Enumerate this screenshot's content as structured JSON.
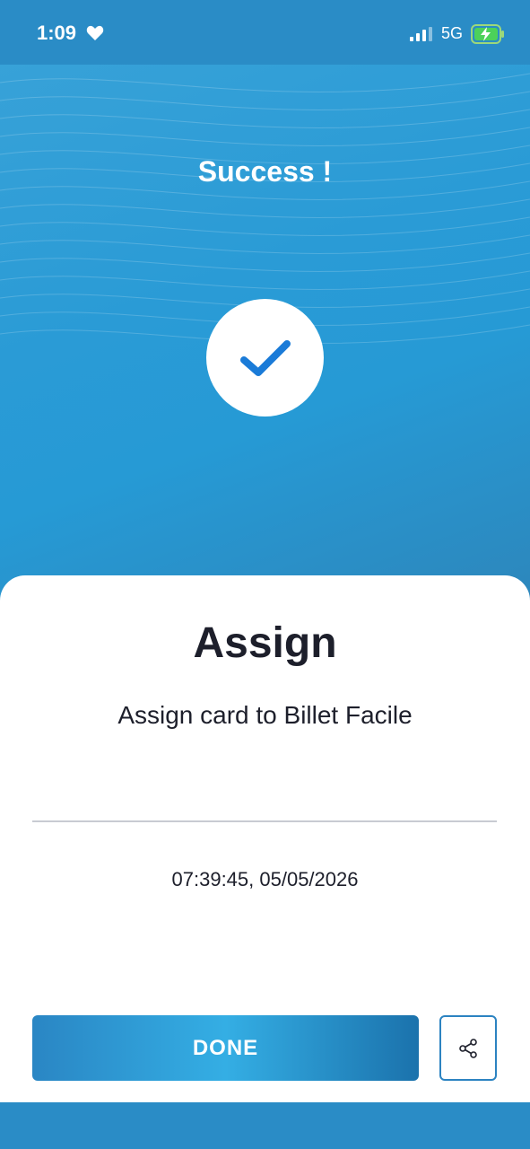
{
  "status_bar": {
    "time": "1:09",
    "network": "5G",
    "icons": [
      "heart-icon",
      "signal-icon",
      "battery-charging-icon"
    ]
  },
  "hero": {
    "title": "Success !",
    "icon": "checkmark-icon"
  },
  "sheet": {
    "title": "Assign",
    "subtitle": "Assign card to Billet Facile",
    "timestamp": "07:39:45, 05/05/2026"
  },
  "actions": {
    "done_label": "DONE",
    "share_icon": "share-icon"
  },
  "colors": {
    "accent": "#2a9bd6",
    "check": "#1a7bd8",
    "text": "#1d1f2b"
  }
}
